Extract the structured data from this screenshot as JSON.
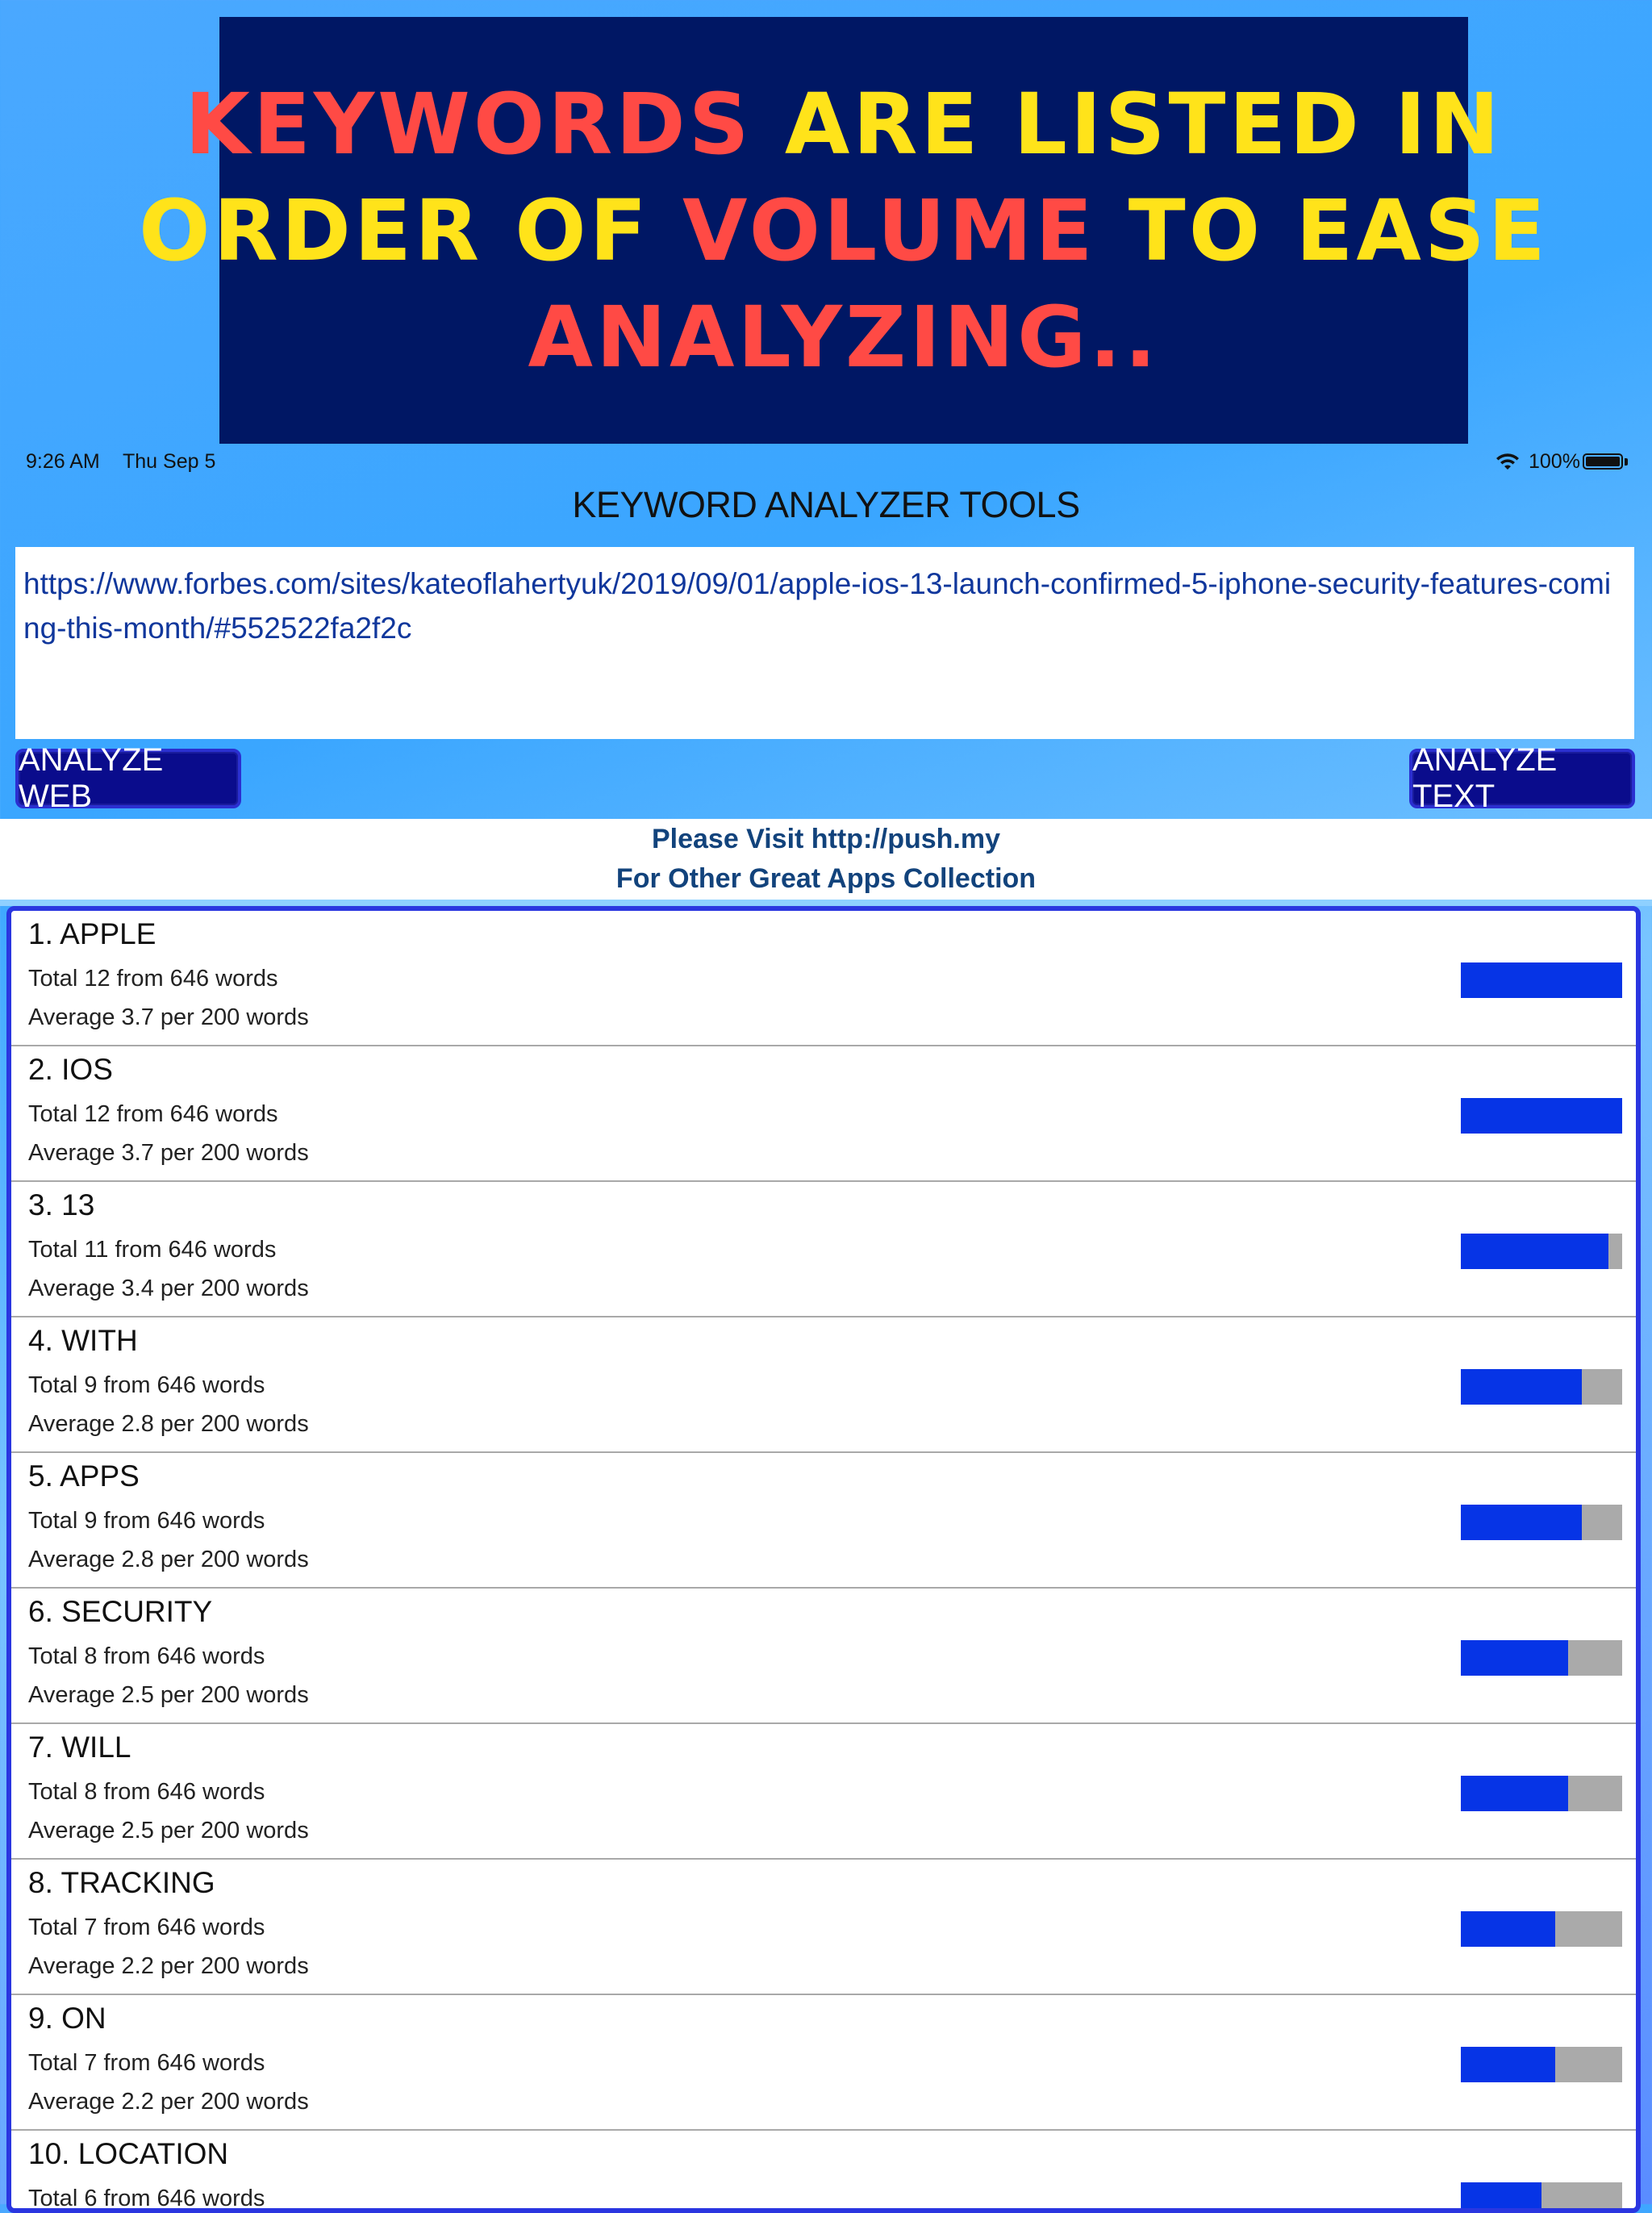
{
  "banner": {
    "line1": [
      {
        "text": "KEYWORDS",
        "color": "red"
      },
      {
        "text": " ARE LISTED IN",
        "color": "yellow"
      }
    ],
    "line2": [
      {
        "text": "ORDER OF ",
        "color": "yellow"
      },
      {
        "text": "VOLUME",
        "color": "red"
      },
      {
        "text": " TO EASE",
        "color": "yellow"
      }
    ],
    "line3": [
      {
        "text": "ANALYZING..",
        "color": "red"
      }
    ],
    "colors": {
      "red": "#ff4a45",
      "yellow": "#ffe31a",
      "background": "#001764"
    }
  },
  "statusbar": {
    "time": "9:26 AM",
    "date": "Thu Sep 5",
    "battery": "100%",
    "icons": [
      "wifi-icon",
      "battery-icon"
    ]
  },
  "app": {
    "title": "KEYWORD ANALYZER TOOLS",
    "url": "https://www.forbes.com/sites/kateoflahertyuk/2019/09/01/apple-ios-13-launch-confirmed-5-iphone-security-features-coming-this-month/#552522fa2f2c",
    "analyze_web_label": "ANALYZE WEB",
    "analyze_text_label": "ANALYZE TEXT"
  },
  "promo": {
    "line1": "Please Visit http://push.my",
    "line2": "For Other Great Apps Collection"
  },
  "keywords": [
    {
      "title": "1. APPLE",
      "total": "Total 12 from 646 words",
      "average": "Average 3.7 per 200 words",
      "fill": 1.0
    },
    {
      "title": "2. IOS",
      "total": "Total 12 from 646 words",
      "average": "Average 3.7 per 200 words",
      "fill": 1.0
    },
    {
      "title": "3. 13",
      "total": "Total 11 from 646 words",
      "average": "Average 3.4 per 200 words",
      "fill": 0.917
    },
    {
      "title": "4. WITH",
      "total": "Total 9 from 646 words",
      "average": "Average 2.8 per 200 words",
      "fill": 0.75
    },
    {
      "title": "5. APPS",
      "total": "Total 9 from 646 words",
      "average": "Average 2.8 per 200 words",
      "fill": 0.75
    },
    {
      "title": "6. SECURITY",
      "total": "Total 8 from 646 words",
      "average": "Average 2.5 per 200 words",
      "fill": 0.667
    },
    {
      "title": "7. WILL",
      "total": "Total 8 from 646 words",
      "average": "Average 2.5 per 200 words",
      "fill": 0.667
    },
    {
      "title": "8. TRACKING",
      "total": "Total 7 from 646 words",
      "average": "Average 2.2 per 200 words",
      "fill": 0.583
    },
    {
      "title": "9. ON",
      "total": "Total 7 from 646 words",
      "average": "Average 2.2 per 200 words",
      "fill": 0.583
    },
    {
      "title": "10. LOCATION",
      "total": "Total 6 from 646 words",
      "average": "",
      "fill": 0.5
    }
  ]
}
